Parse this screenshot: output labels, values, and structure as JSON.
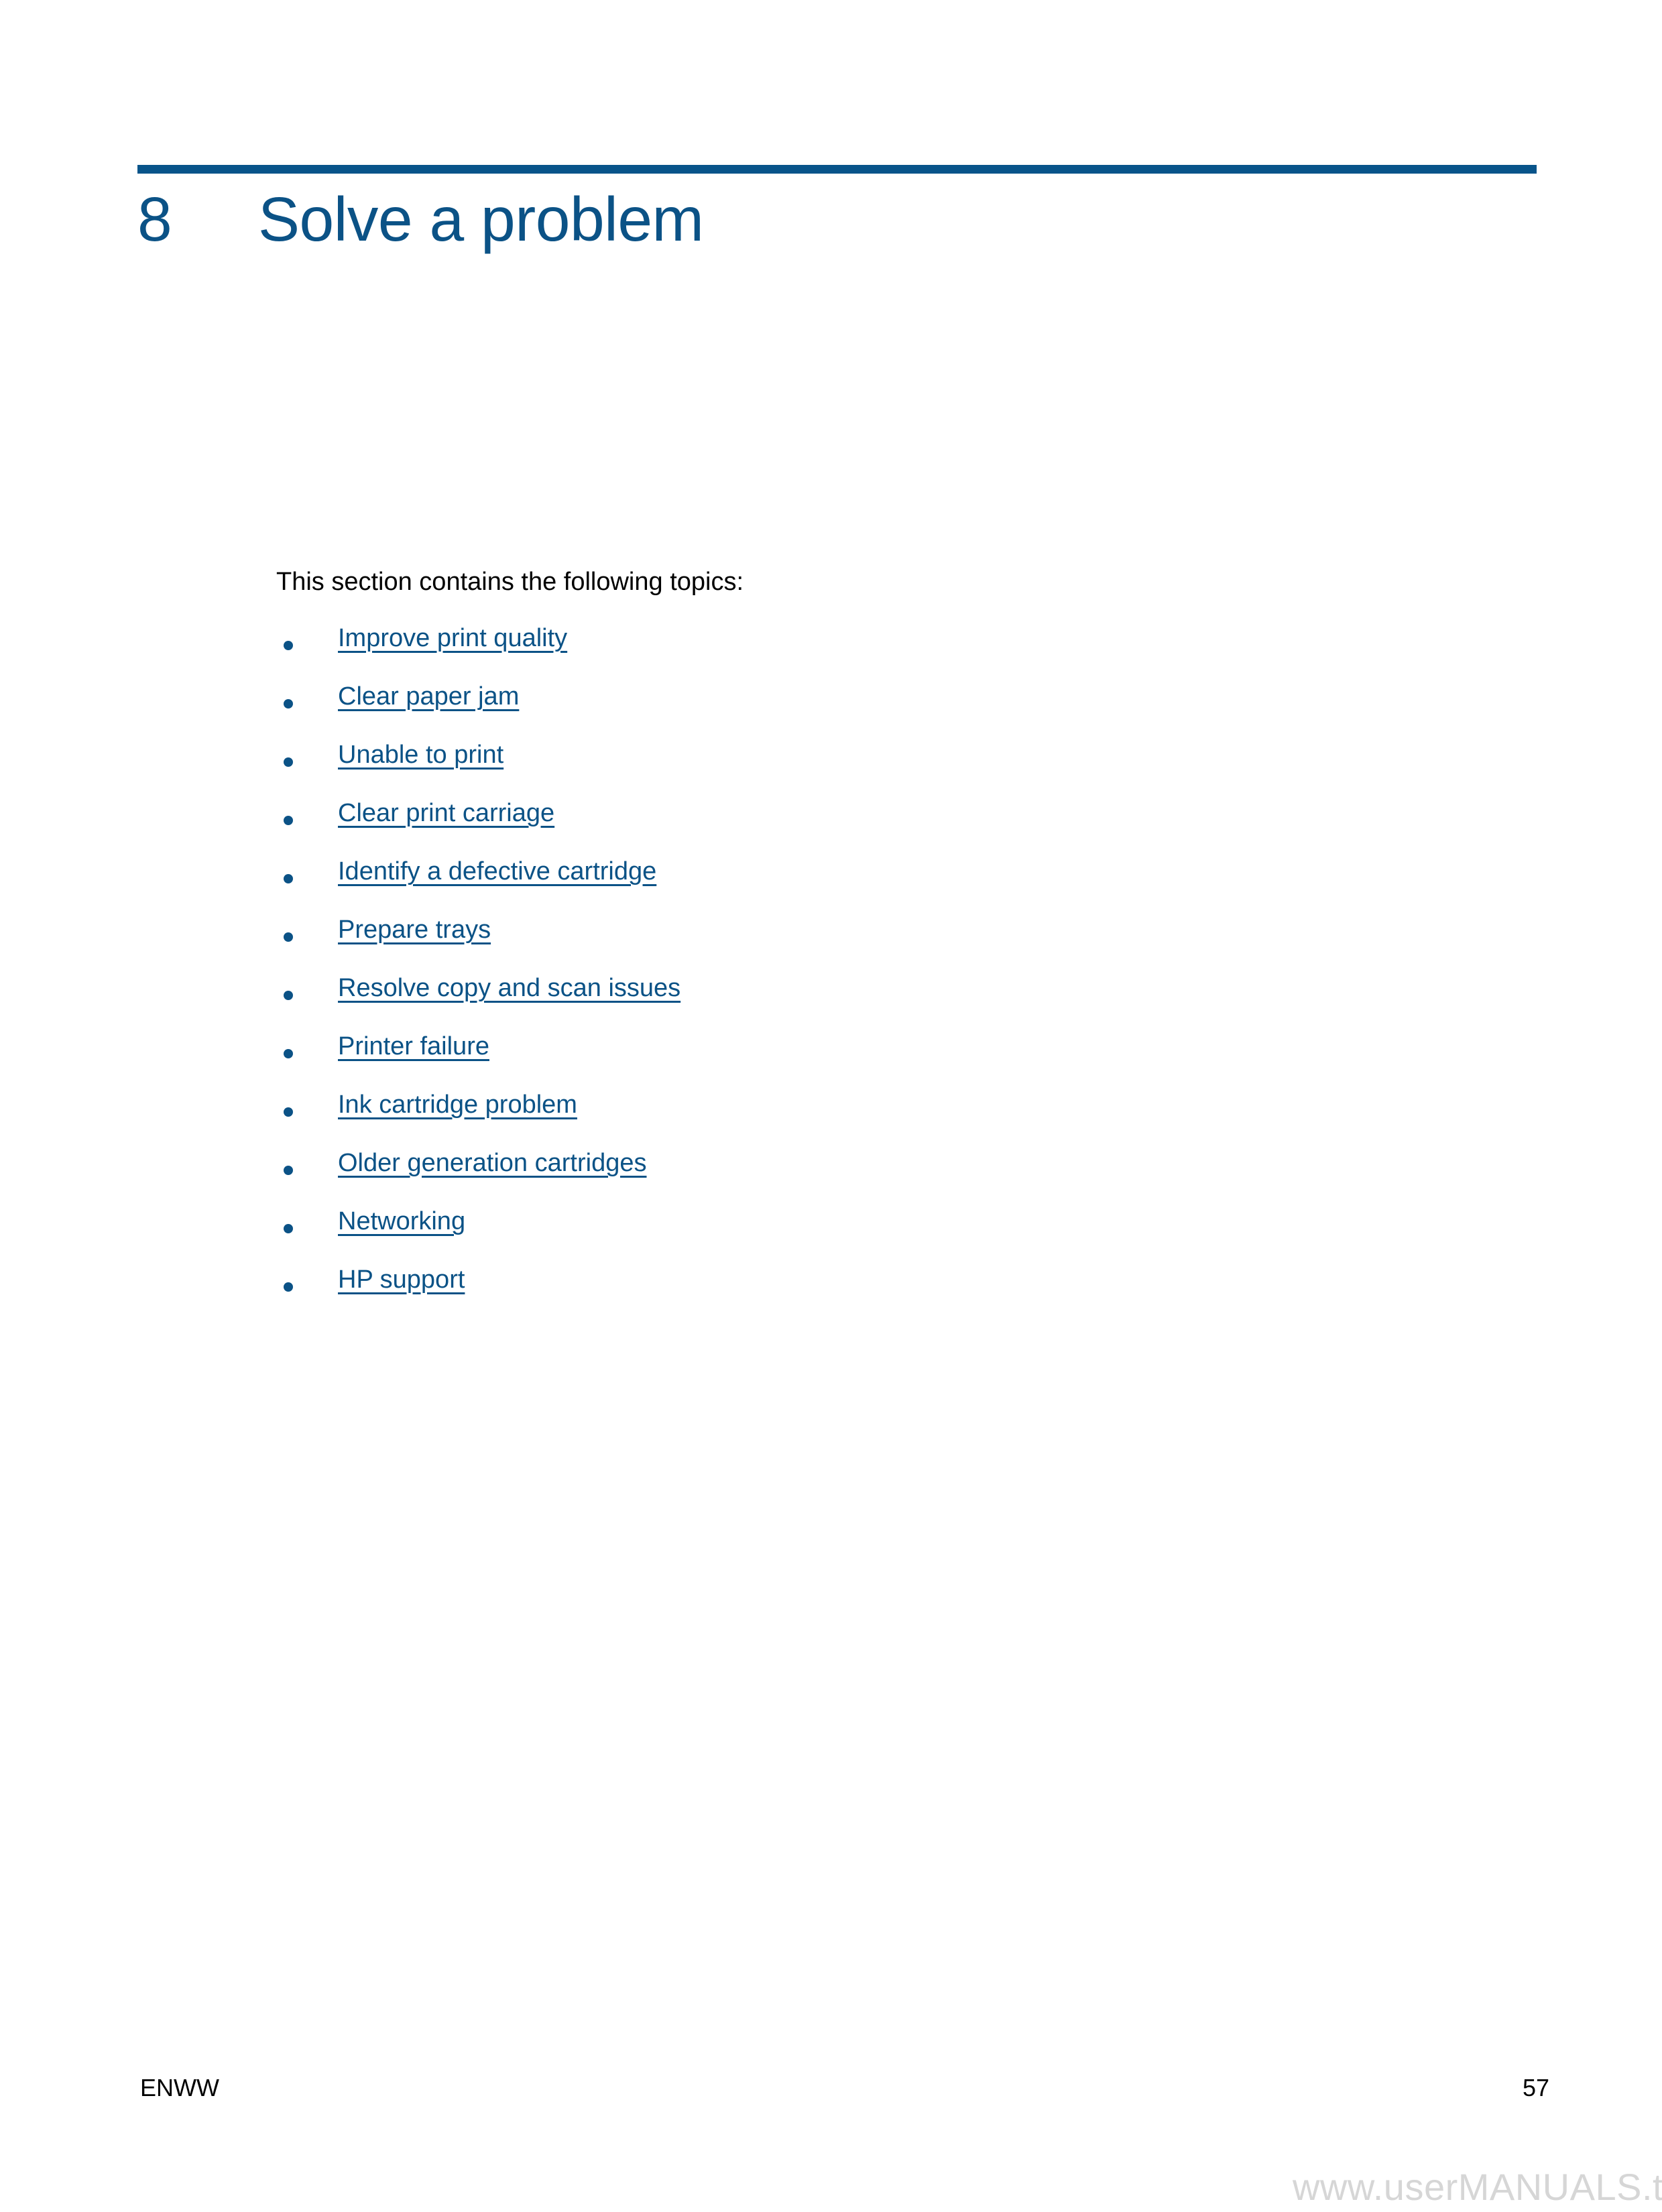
{
  "document": {
    "chapter_number": "8",
    "chapter_title": "Solve a problem",
    "intro": "This section contains the following topics:"
  },
  "colors": {
    "accent_blue": "#0B5286",
    "rule_blue": "#08548A",
    "body_text": "#000000",
    "watermark_gray": "#D6D6D6"
  },
  "topics": [
    {
      "label": "Improve print quality"
    },
    {
      "label": "Clear paper jam"
    },
    {
      "label": "Unable to print"
    },
    {
      "label": "Clear print carriage"
    },
    {
      "label": "Identify a defective cartridge"
    },
    {
      "label": "Prepare trays"
    },
    {
      "label": "Resolve copy and scan issues"
    },
    {
      "label": "Printer failure"
    },
    {
      "label": "Ink cartridge problem"
    },
    {
      "label": "Older generation cartridges"
    },
    {
      "label": "Networking"
    },
    {
      "label": "HP support"
    }
  ],
  "footer": {
    "left_label": "ENWW",
    "page_number": "57"
  },
  "watermark": {
    "text": "www.userMANUALS.tech"
  }
}
